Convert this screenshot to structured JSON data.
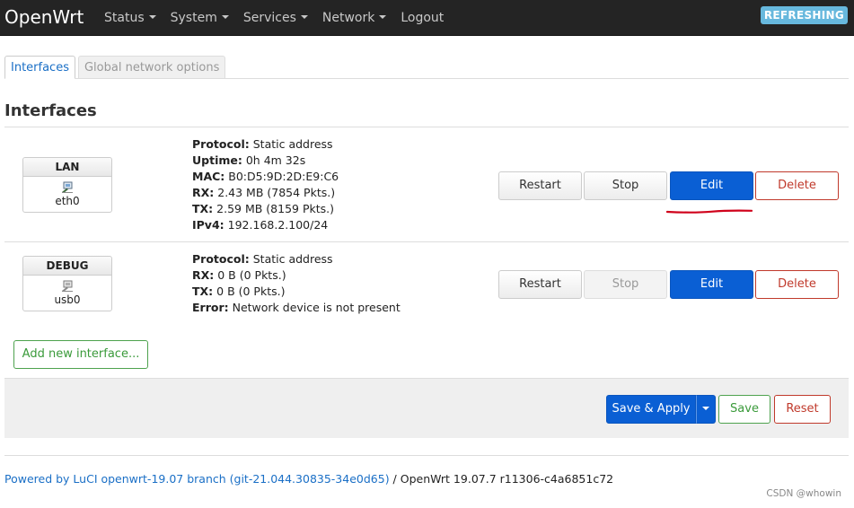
{
  "header": {
    "brand": "OpenWrt",
    "nav": [
      {
        "label": "Status",
        "dropdown": true
      },
      {
        "label": "System",
        "dropdown": true
      },
      {
        "label": "Services",
        "dropdown": true
      },
      {
        "label": "Network",
        "dropdown": true
      },
      {
        "label": "Logout",
        "dropdown": false
      }
    ],
    "badge": "REFRESHING"
  },
  "tabs": {
    "interfaces": "Interfaces",
    "global": "Global network options"
  },
  "section_title": "Interfaces",
  "interfaces": [
    {
      "name": "LAN",
      "device": "eth0",
      "info": {
        "protocol_label": "Protocol:",
        "protocol": "Static address",
        "uptime_label": "Uptime:",
        "uptime": "0h 4m 32s",
        "mac_label": "MAC:",
        "mac": "B0:D5:9D:2D:E9:C6",
        "rx_label": "RX:",
        "rx": "2.43 MB (7854 Pkts.)",
        "tx_label": "TX:",
        "tx": "2.59 MB (8159 Pkts.)",
        "ipv4_label": "IPv4:",
        "ipv4": "192.168.2.100/24"
      }
    },
    {
      "name": "DEBUG",
      "device": "usb0",
      "info": {
        "protocol_label": "Protocol:",
        "protocol": "Static address",
        "rx_label": "RX:",
        "rx": "0 B (0 Pkts.)",
        "tx_label": "TX:",
        "tx": "0 B (0 Pkts.)",
        "error_label": "Error:",
        "error": "Network device is not present"
      }
    }
  ],
  "buttons": {
    "restart": "Restart",
    "stop": "Stop",
    "edit": "Edit",
    "delete": "Delete",
    "add_interface": "Add new interface...",
    "save_apply": "Save & Apply",
    "save": "Save",
    "reset": "Reset"
  },
  "footer": {
    "link": "Powered by LuCI openwrt-19.07 branch (git-21.044.30835-34e0d65)",
    "version": " / OpenWrt 19.07.7 r11306-c4a6851c72"
  },
  "watermark": "CSDN @whowin",
  "colors": {
    "header_bg": "#242424",
    "primary": "#0a5fd4",
    "danger": "#c0392b",
    "success": "#3a9a3a",
    "badge": "#67b8dd",
    "annotation": "#d0021b"
  }
}
